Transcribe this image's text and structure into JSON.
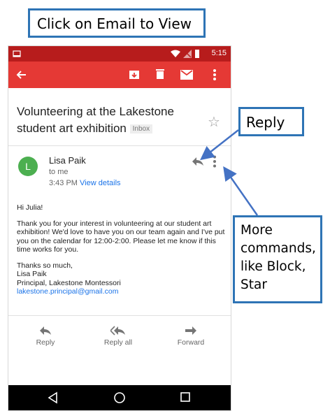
{
  "callouts": {
    "title": "Click on Email to View",
    "reply": "Reply",
    "more": [
      "More",
      "commands,",
      "like Block,",
      "Star"
    ]
  },
  "status_bar": {
    "time": "5:15"
  },
  "email": {
    "subject": "Volunteering at the Lakestone student art exhibition",
    "label": "Inbox",
    "avatar_letter": "L",
    "sender": "Lisa Paik",
    "to": "to me",
    "time": "3:43 PM",
    "view_details": "View details",
    "greeting": "Hi Julia!",
    "paragraph": "Thank you for your interest in volunteering at our student art exhibition!  We'd love to have you on our team again and I've put you on the calendar for 12:00-2:00.  Please let me know if this time works for you.",
    "signoff": "Thanks so much,",
    "sig_name": "Lisa Paik",
    "sig_title": "Principal, Lakestone Montessori",
    "sig_email": "lakestone.principal@gmail.com"
  },
  "actions": {
    "reply": "Reply",
    "reply_all": "Reply all",
    "forward": "Forward"
  },
  "colors": {
    "appbar": "#e53935",
    "statusbar": "#b71c1c",
    "avatar": "#4caf50",
    "link": "#1a73e8",
    "callout_border": "#2e74b5",
    "arrow": "#4472c4"
  },
  "icons": [
    "back-arrow-icon",
    "archive-icon",
    "delete-icon",
    "mark-unread-icon",
    "overflow-menu-icon",
    "star-icon",
    "reply-icon",
    "reply-all-icon",
    "forward-icon",
    "nav-back-icon",
    "nav-home-icon",
    "nav-recents-icon"
  ]
}
